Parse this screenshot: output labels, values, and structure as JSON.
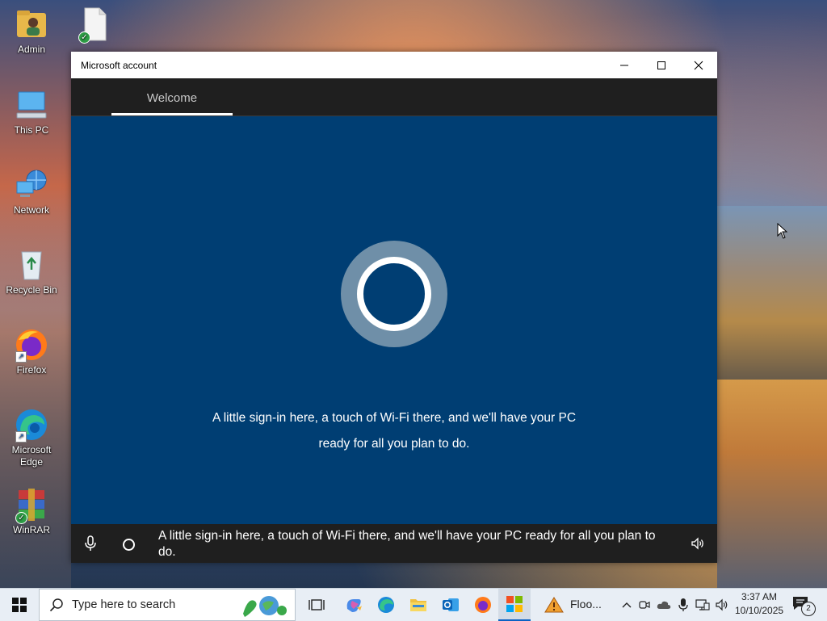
{
  "desktop": {
    "icons": [
      {
        "label": "Admin"
      },
      {
        "label": ""
      },
      {
        "label": "This PC"
      },
      {
        "label": "Network"
      },
      {
        "label": "Recycle Bin"
      },
      {
        "label": "Firefox"
      },
      {
        "label": "Microsoft Edge"
      },
      {
        "label": "WinRAR"
      }
    ]
  },
  "window": {
    "title": "Microsoft account",
    "nav_tab": "Welcome",
    "message_line1": "A little sign-in here, a touch of Wi-Fi there, and we'll have your PC",
    "message_line2": "ready for all you plan to do.",
    "caption": "A little sign-in here, a touch of Wi-Fi there, and we'll have your PC ready for all you plan to do."
  },
  "taskbar": {
    "search_placeholder": "Type here to search",
    "floo_label": "Floo...",
    "time": "3:37 AM",
    "date": "10/10/2025",
    "notification_count": "2"
  },
  "colors": {
    "window_bg": "#003e73",
    "dark_bar": "#1f1f1f",
    "taskbar_bg": "#e8eef5"
  }
}
